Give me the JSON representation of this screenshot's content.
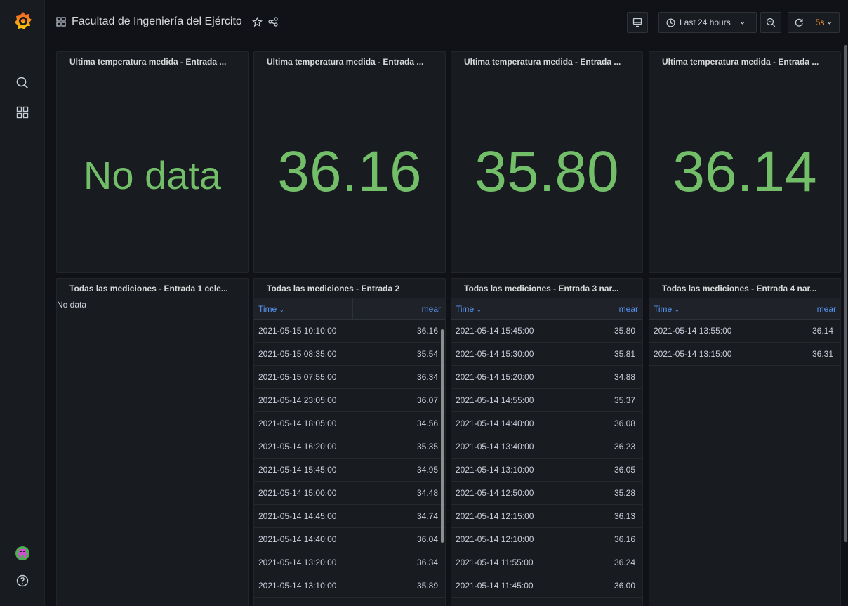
{
  "colors": {
    "value_green": "#73bf69",
    "accent_blue": "#5794f2",
    "refresh_orange": "#ff9830"
  },
  "header": {
    "dashboard_title": "Facultad de Ingeniería del Ejército",
    "time_range": "Last 24 hours",
    "refresh_interval": "5s"
  },
  "stats": [
    {
      "title": "Ultima temperatura medida - Entrada ...",
      "value": "No data"
    },
    {
      "title": "Ultima temperatura medida - Entrada ...",
      "value": "36.16"
    },
    {
      "title": "Ultima temperatura medida - Entrada ...",
      "value": "35.80"
    },
    {
      "title": "Ultima temperatura medida - Entrada ...",
      "value": "36.14"
    }
  ],
  "tables": [
    {
      "title": "Todas las mediciones - Entrada 1 cele...",
      "no_data": "No data",
      "rows": []
    },
    {
      "title": "Todas las mediciones - Entrada 2",
      "col_time": "Time",
      "col_mean": "mear",
      "rows": [
        {
          "time": "2021-05-15 10:10:00",
          "mean": "36.16"
        },
        {
          "time": "2021-05-15 08:35:00",
          "mean": "35.54"
        },
        {
          "time": "2021-05-15 07:55:00",
          "mean": "36.34"
        },
        {
          "time": "2021-05-14 23:05:00",
          "mean": "36.07"
        },
        {
          "time": "2021-05-14 18:05:00",
          "mean": "34.56"
        },
        {
          "time": "2021-05-14 16:20:00",
          "mean": "35.35"
        },
        {
          "time": "2021-05-14 15:45:00",
          "mean": "34.95"
        },
        {
          "time": "2021-05-14 15:00:00",
          "mean": "34.48"
        },
        {
          "time": "2021-05-14 14:45:00",
          "mean": "34.74"
        },
        {
          "time": "2021-05-14 14:40:00",
          "mean": "36.04"
        },
        {
          "time": "2021-05-14 13:20:00",
          "mean": "36.34"
        },
        {
          "time": "2021-05-14 13:10:00",
          "mean": "35.89"
        }
      ]
    },
    {
      "title": "Todas las mediciones - Entrada 3 nar...",
      "col_time": "Time",
      "col_mean": "mear",
      "rows": [
        {
          "time": "2021-05-14 15:45:00",
          "mean": "35.80"
        },
        {
          "time": "2021-05-14 15:30:00",
          "mean": "35.81"
        },
        {
          "time": "2021-05-14 15:20:00",
          "mean": "34.88"
        },
        {
          "time": "2021-05-14 14:55:00",
          "mean": "35.37"
        },
        {
          "time": "2021-05-14 14:40:00",
          "mean": "36.08"
        },
        {
          "time": "2021-05-14 13:40:00",
          "mean": "36.23"
        },
        {
          "time": "2021-05-14 13:10:00",
          "mean": "36.05"
        },
        {
          "time": "2021-05-14 12:50:00",
          "mean": "35.28"
        },
        {
          "time": "2021-05-14 12:15:00",
          "mean": "36.13"
        },
        {
          "time": "2021-05-14 12:10:00",
          "mean": "36.16"
        },
        {
          "time": "2021-05-14 11:55:00",
          "mean": "36.24"
        },
        {
          "time": "2021-05-14 11:45:00",
          "mean": "36.00"
        }
      ]
    },
    {
      "title": "Todas las mediciones - Entrada 4 nar...",
      "col_time": "Time",
      "col_mean": "mear",
      "rows": [
        {
          "time": "2021-05-14 13:55:00",
          "mean": "36.14"
        },
        {
          "time": "2021-05-14 13:15:00",
          "mean": "36.31"
        }
      ]
    }
  ]
}
